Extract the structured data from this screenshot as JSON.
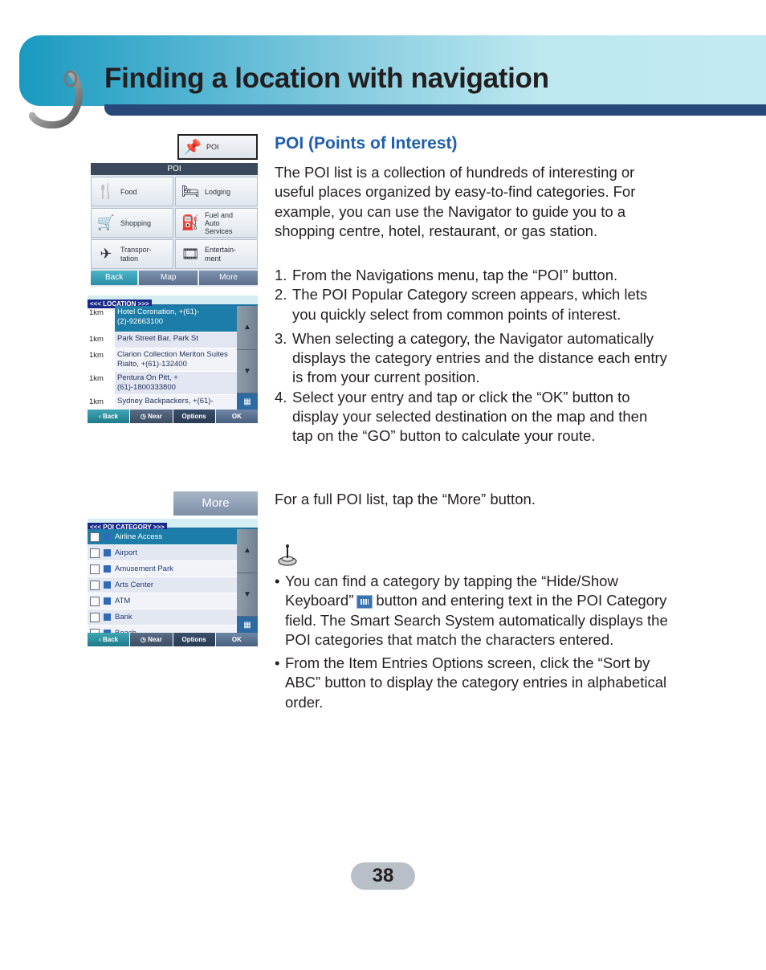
{
  "header": {
    "title": "Finding a location with navigation"
  },
  "screens": {
    "poi_button": {
      "label": "POI",
      "icon": "pushpin-star-icon"
    },
    "poi_menu": {
      "title": "POI",
      "items": [
        {
          "label": "Food",
          "icon": "fork-knife-icon"
        },
        {
          "label": "Lodging",
          "icon": "bed-icon"
        },
        {
          "label": "Shopping",
          "icon": "shopping-cart-icon"
        },
        {
          "label": "Fuel and Auto Services",
          "icon": "fuel-pump-icon"
        },
        {
          "label": "Transpor-tation",
          "icon": "airplane-icon"
        },
        {
          "label": "Entertain-ment",
          "icon": "film-reel-icon"
        }
      ],
      "nav": {
        "back": "Back",
        "map": "Map",
        "more": "More"
      }
    },
    "location_list": {
      "title": "<<<  LOCATION  >>>",
      "rows": [
        {
          "dist": "1km",
          "name": "Hotel Coronation, +(61)-(2)-92663100",
          "selected": true
        },
        {
          "dist": "1km",
          "name": "Park Street Bar, Park St"
        },
        {
          "dist": "1km",
          "name": "Clarion Collection Meriton Suites Rialto, +(61)-132400"
        },
        {
          "dist": "1km",
          "name": "Pentura On Pitt, +(61)-1800333800"
        },
        {
          "dist": "1km",
          "name": "Sydney Backpackers, +(61)-"
        }
      ],
      "bar": {
        "back": "Back",
        "near": "Near",
        "options": "Options",
        "ok": "OK"
      }
    },
    "more_button": {
      "label": "More"
    },
    "category_list": {
      "title": "<<<  POI CATEGORY  >>>",
      "rows": [
        {
          "name": "Airline Access",
          "selected": true
        },
        {
          "name": "Airport"
        },
        {
          "name": "Amusement Park"
        },
        {
          "name": "Arts Center"
        },
        {
          "name": "ATM"
        },
        {
          "name": "Bank"
        },
        {
          "name": "Beach"
        }
      ],
      "bar": {
        "back": "Back",
        "near": "Near",
        "options": "Options",
        "ok": "OK"
      }
    }
  },
  "content": {
    "section_title": "POI (Points of Interest)",
    "intro": "The POI list is a collection of hundreds of interesting or useful places organized by easy-to-find categories. For example, you can use the Navigator to guide you to a shopping centre, hotel, restaurant, or gas station.",
    "steps": [
      {
        "num": "1.",
        "text": "From the Navigations menu, tap the “POI” button."
      },
      {
        "num": "2.",
        "text": "The POI Popular Category screen appears, which lets you quickly select from common points of interest."
      },
      {
        "num": "3.",
        "text": "When selecting a category, the Navigator automatically displays the category entries and the distance each entry is from your current position."
      },
      {
        "num": "4.",
        "text": "Select your entry and tap or click the “OK” button to display your selected destination on the map and then tap on the “GO” button to calculate your route."
      }
    ],
    "more_note": "For a full POI list, tap the “More” button.",
    "note_icon": "joystick-note-icon",
    "bullets": [
      {
        "before": "You can find a category by tapping the “Hide/Show Keyboard”",
        "after": "button and entering text in the POI Category field. The Smart Search System automatically displays the POI categories that match the characters entered."
      },
      {
        "before": "From the Item Entries Options screen, click the “Sort by ABC” button to display the category entries in alphabetical order.",
        "after": ""
      }
    ]
  },
  "footer": {
    "page_number": "38"
  }
}
